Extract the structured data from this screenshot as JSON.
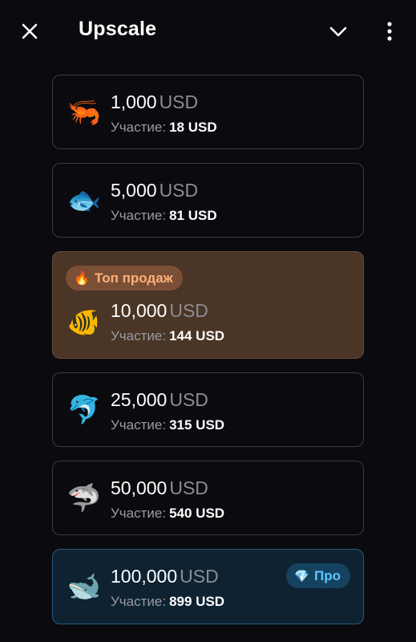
{
  "header": {
    "title": "Upscale",
    "close_icon": "close-icon",
    "chevron_icon": "chevron-down-icon",
    "more_icon": "more-vertical-icon"
  },
  "plans": [
    {
      "icon": "shrimp-icon",
      "emoji": "🦐",
      "amount": "1,000",
      "currency": "USD",
      "participation_label": "Участие:",
      "participation_value": "18 USD"
    },
    {
      "icon": "fish-icon",
      "emoji": "🐟",
      "amount": "5,000",
      "currency": "USD",
      "participation_label": "Участие:",
      "participation_value": "81 USD"
    },
    {
      "icon": "tropical-fish-icon",
      "emoji": "🐠",
      "amount": "10,000",
      "currency": "USD",
      "participation_label": "Участие:",
      "participation_value": "144 USD",
      "badge": {
        "icon": "fire-icon",
        "emoji": "🔥",
        "label": "Топ продаж"
      }
    },
    {
      "icon": "dolphin-icon",
      "emoji": "🐬",
      "amount": "25,000",
      "currency": "USD",
      "participation_label": "Участие:",
      "participation_value": "315 USD"
    },
    {
      "icon": "shark-icon",
      "emoji": "🦈",
      "amount": "50,000",
      "currency": "USD",
      "participation_label": "Участие:",
      "participation_value": "540 USD"
    },
    {
      "icon": "whale-icon",
      "emoji": "🐋",
      "amount": "100,000",
      "currency": "USD",
      "participation_label": "Участие:",
      "participation_value": "899 USD",
      "badge": {
        "icon": "diamond-icon",
        "emoji": "💎",
        "label": "Про"
      }
    }
  ],
  "colors": {
    "background": "#0b0b0f",
    "card_border": "#3a3a40",
    "top_card_bg": "#4a3526",
    "top_badge_text": "#ffb07a",
    "pro_card_bg": "#0e2232",
    "pro_badge_text": "#5ec3ff",
    "muted_text": "#8c8c94"
  }
}
